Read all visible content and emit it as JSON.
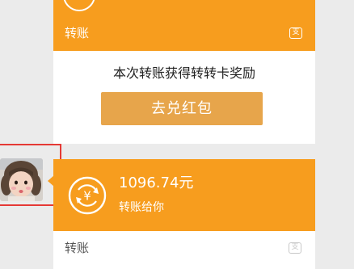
{
  "transfer_top": {
    "type_label": "转账",
    "brand_glyph": "支"
  },
  "reward": {
    "message": "本次转账获得转转卡奖励",
    "button_label": "去兑红包"
  },
  "transfer_bottom": {
    "amount": "1096.74元",
    "subtitle": "转账给你",
    "type_label": "转账",
    "brand_glyph": "支",
    "icon_glyph": "¥"
  },
  "colors": {
    "transfer_orange": "#f79d1e",
    "button_gold": "#e7a54b",
    "highlight_red": "#e53935",
    "background": "#ebebeb"
  }
}
